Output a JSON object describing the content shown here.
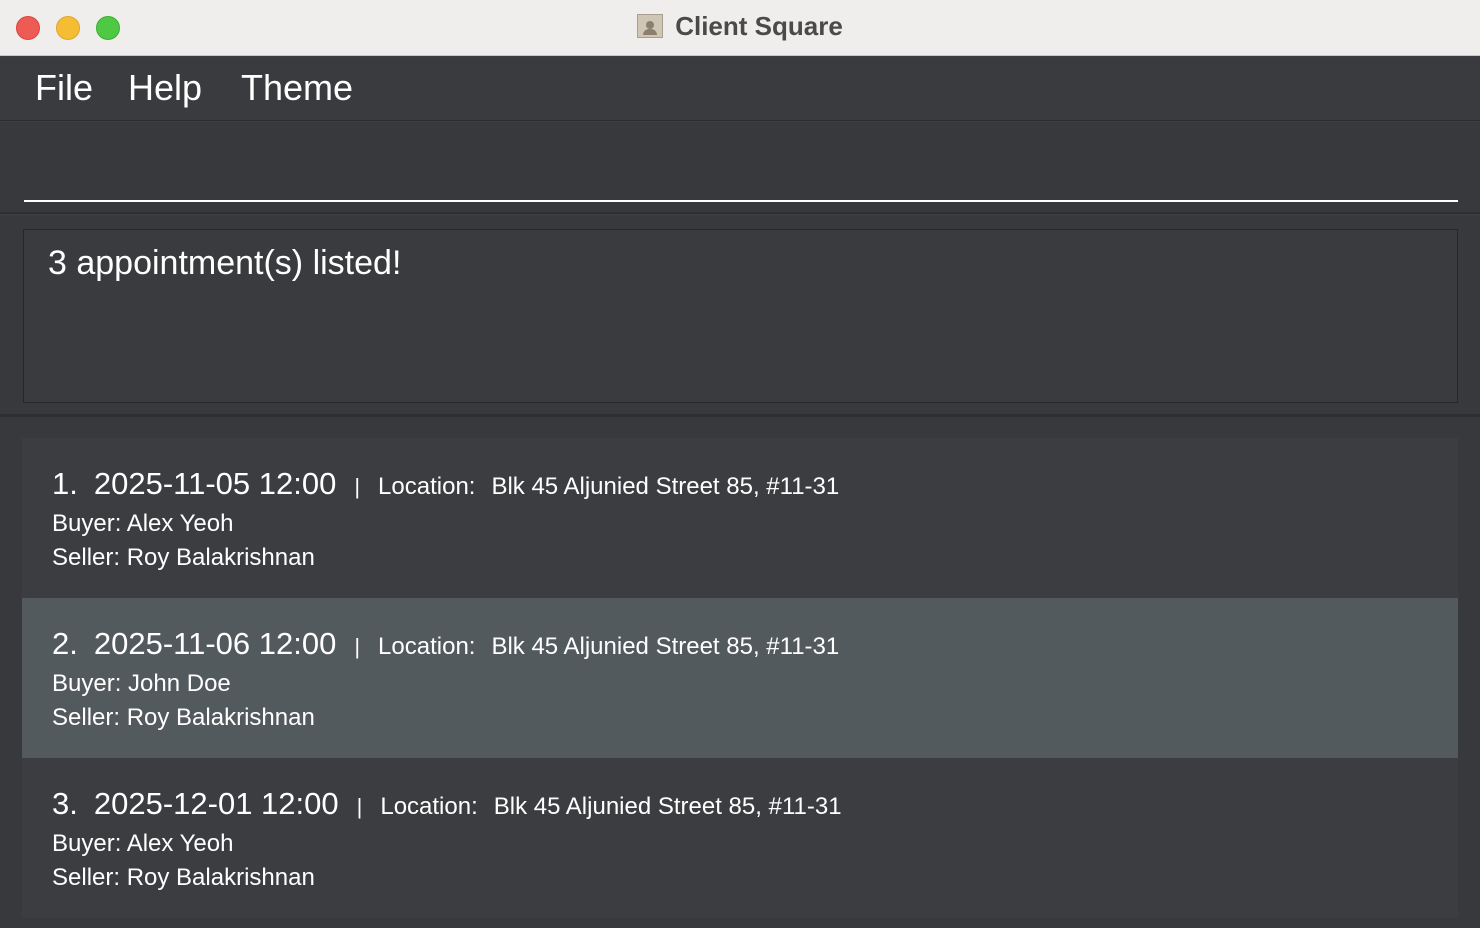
{
  "window": {
    "title": "Client Square"
  },
  "menu": {
    "items": [
      "File",
      "Help",
      "Theme"
    ]
  },
  "command": {
    "value": "",
    "placeholder": ""
  },
  "result": {
    "message": "3 appointment(s) listed!"
  },
  "appointments": [
    {
      "index": "1.",
      "datetime": "2025-11-05 12:00",
      "separator": "|",
      "location_label": "Location:",
      "location": "Blk 45 Aljunied Street 85, #11-31",
      "buyer": "Buyer: Alex Yeoh",
      "seller": "Seller: Roy Balakrishnan"
    },
    {
      "index": "2.",
      "datetime": "2025-11-06 12:00",
      "separator": "|",
      "location_label": "Location:",
      "location": "Blk 45 Aljunied Street 85, #11-31",
      "buyer": "Buyer: John Doe",
      "seller": "Seller: Roy Balakrishnan"
    },
    {
      "index": "3.",
      "datetime": "2025-12-01 12:00",
      "separator": "|",
      "location_label": "Location:",
      "location": "Blk 45 Aljunied Street 85, #11-31",
      "buyer": "Buyer: Alex Yeoh",
      "seller": "Seller: Roy Balakrishnan"
    }
  ],
  "colors": {
    "background": "#3c3d40",
    "selected_card": "#525a5e",
    "text": "#ffffff"
  }
}
